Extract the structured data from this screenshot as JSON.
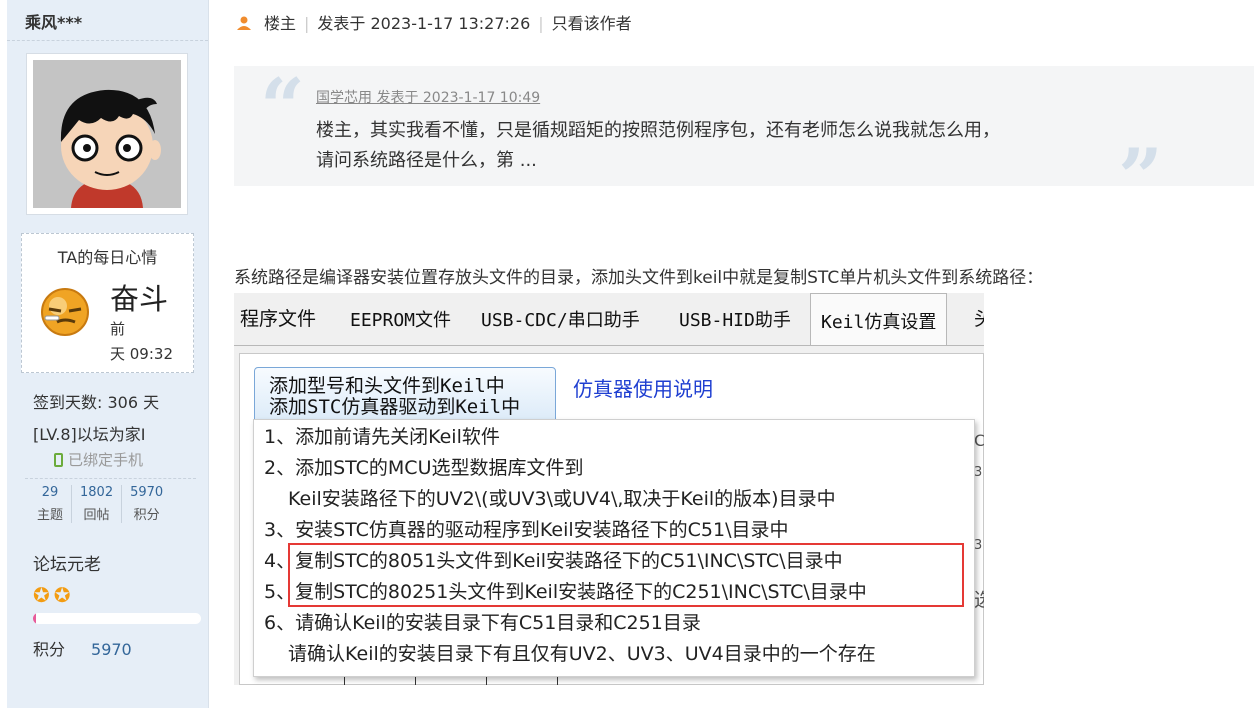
{
  "profile": {
    "username": "乘风***",
    "mood_title": "TA的每日心情",
    "mood_word": "奋斗",
    "mood_time_line1": "前",
    "mood_time_line2": "天 09:32",
    "sign_days": "签到天数: 306 天",
    "level": "[LV.8]以坛为家I",
    "phone_bound": "已绑定手机",
    "counts": [
      {
        "value": "29",
        "label": "主题"
      },
      {
        "value": "1802",
        "label": "回帖"
      },
      {
        "value": "5970",
        "label": "积分"
      }
    ],
    "rank_title": "论坛元老",
    "progress_fraction": 0.02,
    "score_label": "积分",
    "score_value": "5970",
    "colors": {
      "sidebar_bg": "#e6eef7",
      "accent_link": "#336699",
      "progress": "#e75b9a",
      "sun": "#f39c12"
    }
  },
  "post": {
    "floor_label": "楼主",
    "posted_at": "发表于 2023-1-17 13:27:26",
    "only_author": "只看该作者",
    "quote": {
      "meta": "国学芯用 发表于 2023-1-17 10:49",
      "line1": "楼主，其实我看不懂，只是循规蹈矩的按照范例程序包，还有老师怎么说我就怎么用，",
      "line2": "请问系统路径是什么，第 ..."
    },
    "body": "系统路径是编译器安装位置存放头文件的目录，添加头文件到keil中就是复制STC单片机头文件到系统路径："
  },
  "screenshot": {
    "tabs": [
      "程序文件",
      "EEPROM文件",
      "USB-CDC/串口助手",
      "USB-HID助手",
      "Keil仿真设置",
      "头"
    ],
    "active_tab": 4,
    "add_button_line1": "添加型号和头文件到Keil中",
    "add_button_line2": "添加STC仿真器驱动到Keil中",
    "sim_link": "仿真器使用说明",
    "tooltip_lines": [
      "1、添加前请先关闭Keil软件",
      "2、添加STC的MCU选型数据库文件到",
      "Keil安装路径下的UV2\\(或UV3\\或UV4\\,取决于Keil的版本)目录中",
      "3、安装STC仿真器的驱动程序到Keil安装路径下的C51\\目录中",
      "4、复制STC的8051头文件到Keil安装路径下的C51\\INC\\STC\\目录中",
      "5、复制STC的80251头文件到Keil安装路径下的C251\\INC\\STC\\目录中",
      "6、请确认Keil的安装目录下有C51目录和C251目录",
      "请确认Keil的安装目录下有且仅有UV2、UV3、UV4目录中的一个存在"
    ],
    "highlight_color": "#e53935"
  }
}
